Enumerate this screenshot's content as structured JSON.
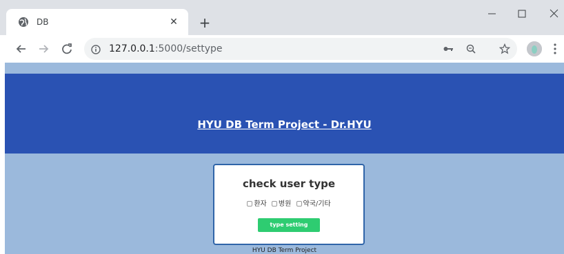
{
  "browser": {
    "tab_title": "DB",
    "url_host": "127.0.0.1",
    "url_rest": ":5000/settype"
  },
  "page": {
    "site_title": "HYU DB Term Project - Dr.HYU",
    "card_title": "check user type",
    "options": [
      "환자",
      "병원",
      "약국/기타"
    ],
    "submit_label": "type setting",
    "footer": "HYU DB Term Project"
  },
  "colors": {
    "header_bg": "#2a52b3",
    "page_bg": "#9bb9dc",
    "card_border": "#2f64a8",
    "button_bg": "#2ecc71"
  },
  "icons": {
    "tab_favicon": "globe-icon",
    "tab_close": "close-icon",
    "new_tab": "plus-icon",
    "back": "back-arrow-icon",
    "forward": "forward-arrow-icon",
    "reload": "reload-icon",
    "site_info": "info-icon",
    "key": "key-icon",
    "zoom": "zoom-icon",
    "bookmark": "star-icon",
    "profile": "avatar",
    "menu": "kebab-menu-icon"
  }
}
